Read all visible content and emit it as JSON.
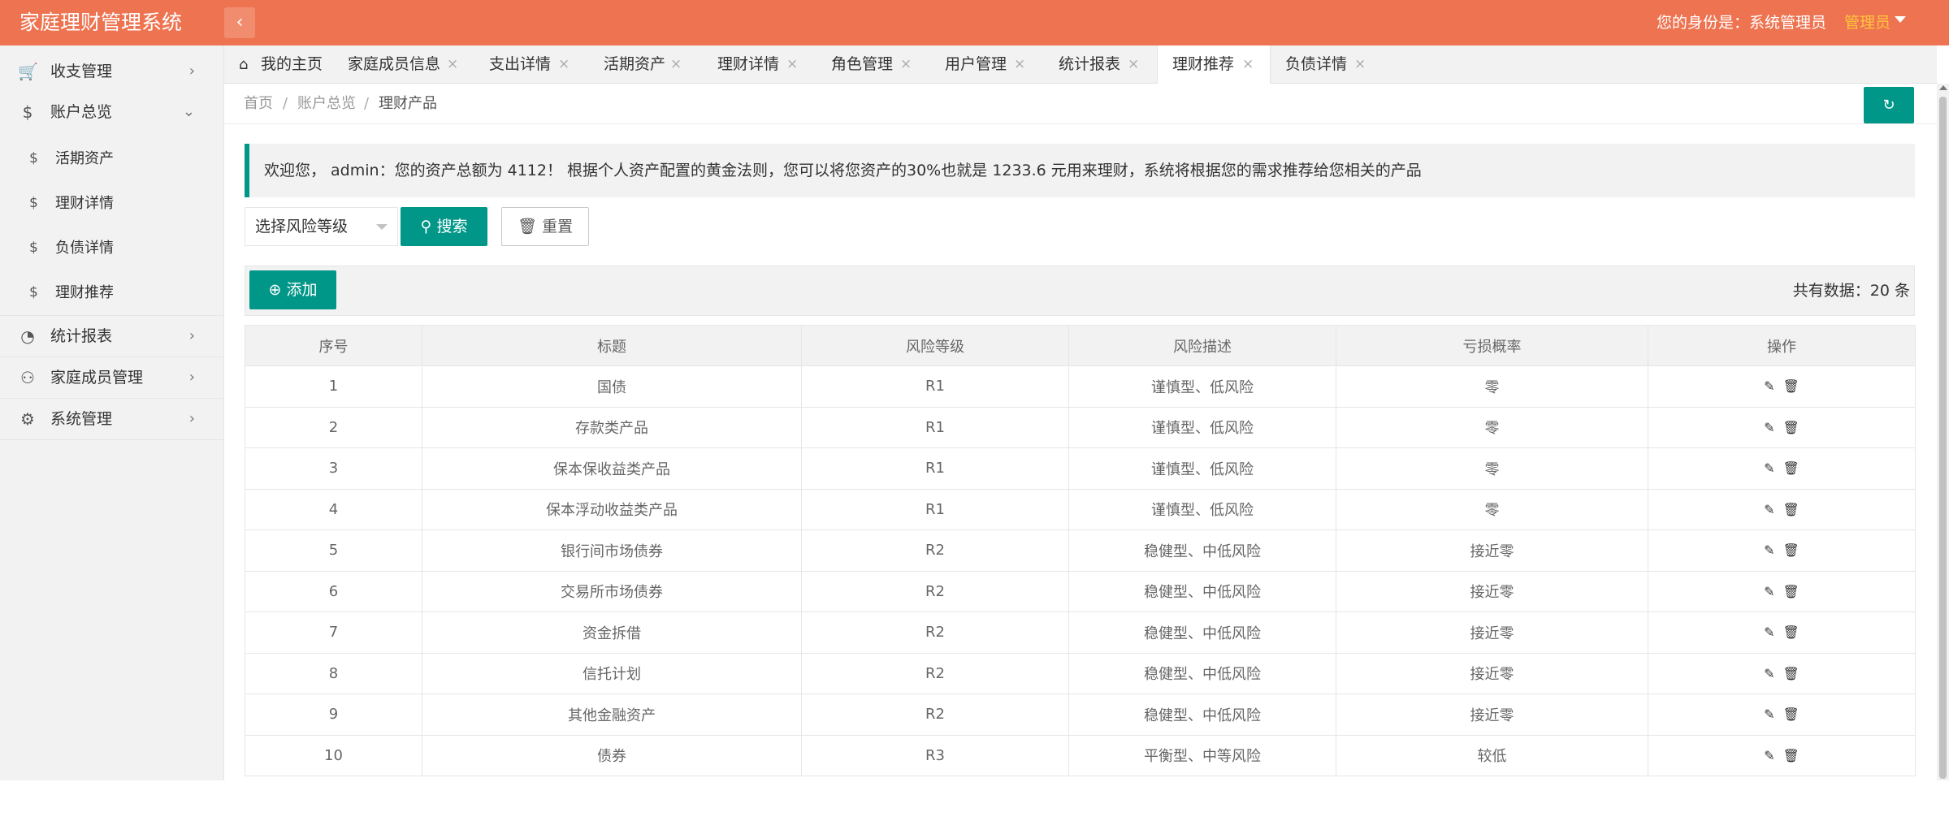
{
  "header": {
    "title": "家庭理财管理系统",
    "collapse_icon": "‹",
    "identity": "您的身份是：系统管理员",
    "role": "管理员"
  },
  "sidebar": {
    "items": [
      {
        "label": "收支管理",
        "icon": "cart-icon",
        "glyph": "🛒",
        "arrow": "›"
      },
      {
        "label": "账户总览",
        "icon": "dollar-icon",
        "glyph": "$",
        "arrow": "⌄"
      },
      {
        "label": "活期资产",
        "icon": "dollar-icon",
        "glyph": "$"
      },
      {
        "label": "理财详情",
        "icon": "dollar-icon",
        "glyph": "$"
      },
      {
        "label": "负债详情",
        "icon": "dollar-icon",
        "glyph": "$"
      },
      {
        "label": "理财推荐",
        "icon": "dollar-icon",
        "glyph": "$"
      },
      {
        "label": "统计报表",
        "icon": "chart-icon",
        "glyph": "◔",
        "arrow": "›"
      },
      {
        "label": "家庭成员管理",
        "icon": "user-icon",
        "glyph": "⚇",
        "arrow": "›"
      },
      {
        "label": "系统管理",
        "icon": "apps-icon",
        "glyph": "⚙",
        "arrow": "›"
      }
    ]
  },
  "tabs": [
    {
      "label": "我的主页"
    },
    {
      "label": "家庭成员信息"
    },
    {
      "label": "支出详情"
    },
    {
      "label": "活期资产"
    },
    {
      "label": "理财详情"
    },
    {
      "label": "角色管理"
    },
    {
      "label": "用户管理"
    },
    {
      "label": "统计报表"
    },
    {
      "label": "理财推荐",
      "active": true
    },
    {
      "label": "负债详情"
    }
  ],
  "tab_close": "×",
  "home_icon": "⌂",
  "breadcrumb": {
    "items": [
      "首页",
      "账户总览",
      "理财产品"
    ],
    "separator": "/"
  },
  "refresh_icon": "↻",
  "notice": "欢迎您， admin：您的资产总额为 4112！ 根据个人资产配置的黄金法则，您可以将您资产的30%也就是 1233.6 元用来理财，系统将根据您的需求推荐给您相关的产品",
  "search": {
    "select_value": "选择风险等级",
    "search_label": "搜索",
    "reset_label": "重置"
  },
  "toolbar": {
    "add_label": "添加",
    "total": "共有数据：20 条"
  },
  "table": {
    "columns": [
      "序号",
      "标题",
      "风险等级",
      "风险描述",
      "亏损概率",
      "操作"
    ],
    "rows": [
      [
        "1",
        "国债",
        "R1",
        "谨慎型、低风险",
        "零"
      ],
      [
        "2",
        "存款类产品",
        "R1",
        "谨慎型、低风险",
        "零"
      ],
      [
        "3",
        "保本保收益类产品",
        "R1",
        "谨慎型、低风险",
        "零"
      ],
      [
        "4",
        "保本浮动收益类产品",
        "R1",
        "谨慎型、低风险",
        "零"
      ],
      [
        "5",
        "银行间市场债券",
        "R2",
        "稳健型、中低风险",
        "接近零"
      ],
      [
        "6",
        "交易所市场债券",
        "R2",
        "稳健型、中低风险",
        "接近零"
      ],
      [
        "7",
        "资金拆借",
        "R2",
        "稳健型、中低风险",
        "接近零"
      ],
      [
        "8",
        "信托计划",
        "R2",
        "稳健型、中低风险",
        "接近零"
      ],
      [
        "9",
        "其他金融资产",
        "R2",
        "稳健型、中低风险",
        "接近零"
      ],
      [
        "10",
        "债券",
        "R3",
        "平衡型、中等风险",
        "较低"
      ]
    ]
  },
  "colors": {
    "header": "#ee7350",
    "accent": "#009688",
    "role": "#ffc53d"
  }
}
